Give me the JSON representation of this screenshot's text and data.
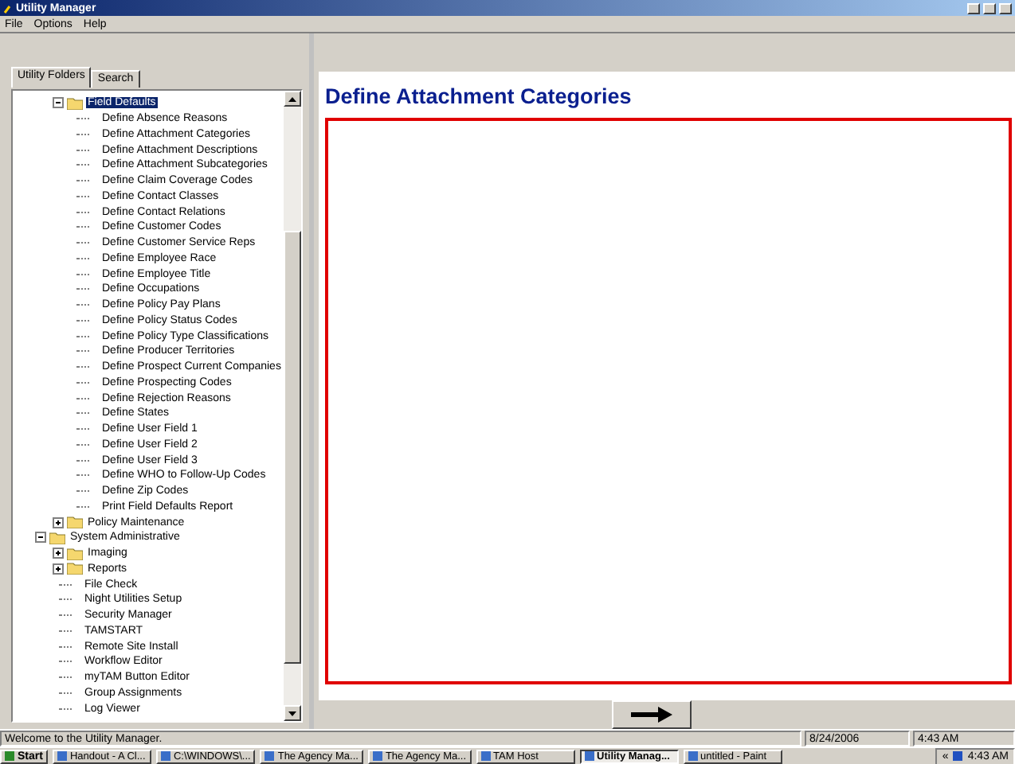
{
  "window": {
    "title": "Utility Manager"
  },
  "menu": [
    "File",
    "Options",
    "Help"
  ],
  "tabs": [
    {
      "label": "Utility Folders",
      "selected": true
    },
    {
      "label": "Search",
      "selected": false
    }
  ],
  "tree": [
    {
      "children": [
        {
          "label": "Field Defaults",
          "kind": "folder",
          "expanded": true,
          "selected": true,
          "children": [
            {
              "label": "Define Absence Reasons",
              "kind": "leaf",
              "selected": false
            },
            {
              "label": "Define Attachment Categories",
              "kind": "leaf",
              "selected": false
            },
            {
              "label": "Define Attachment Descriptions",
              "kind": "leaf",
              "selected": false
            },
            {
              "label": "Define Attachment Subcategories",
              "kind": "leaf",
              "selected": false
            },
            {
              "label": "Define Claim Coverage Codes",
              "kind": "leaf",
              "selected": false
            },
            {
              "label": "Define Contact Classes",
              "kind": "leaf",
              "selected": false
            },
            {
              "label": "Define Contact Relations",
              "kind": "leaf",
              "selected": false
            },
            {
              "label": "Define Customer Codes",
              "kind": "leaf",
              "selected": false
            },
            {
              "label": "Define Customer Service Reps",
              "kind": "leaf",
              "selected": false
            },
            {
              "label": "Define Employee Race",
              "kind": "leaf",
              "selected": false
            },
            {
              "label": "Define Employee Title",
              "kind": "leaf",
              "selected": false
            },
            {
              "label": "Define Occupations",
              "kind": "leaf",
              "selected": false
            },
            {
              "label": "Define Policy Pay Plans",
              "kind": "leaf",
              "selected": false
            },
            {
              "label": "Define Policy Status Codes",
              "kind": "leaf",
              "selected": false
            },
            {
              "label": "Define Policy Type Classifications",
              "kind": "leaf",
              "selected": false
            },
            {
              "label": "Define Producer Territories",
              "kind": "leaf",
              "selected": false
            },
            {
              "label": "Define Prospect Current Companies",
              "kind": "leaf",
              "selected": false
            },
            {
              "label": "Define Prospecting Codes",
              "kind": "leaf",
              "selected": false
            },
            {
              "label": "Define Rejection Reasons",
              "kind": "leaf",
              "selected": false
            },
            {
              "label": "Define States",
              "kind": "leaf",
              "selected": false
            },
            {
              "label": "Define User Field 1",
              "kind": "leaf",
              "selected": false
            },
            {
              "label": "Define User Field 2",
              "kind": "leaf",
              "selected": false
            },
            {
              "label": "Define User Field 3",
              "kind": "leaf",
              "selected": false
            },
            {
              "label": "Define WHO to Follow-Up Codes",
              "kind": "leaf",
              "selected": false
            },
            {
              "label": "Define Zip Codes",
              "kind": "leaf",
              "selected": false
            },
            {
              "label": "Print Field Defaults Report",
              "kind": "leaf",
              "selected": false
            }
          ]
        },
        {
          "label": "Policy Maintenance",
          "kind": "folder",
          "expanded": false,
          "selected": false
        }
      ]
    },
    {
      "label": "System Administrative",
      "kind": "folder",
      "expanded": true,
      "selected": false,
      "children": [
        {
          "label": "Imaging",
          "kind": "folder",
          "expanded": false,
          "selected": false
        },
        {
          "label": "Reports",
          "kind": "folder",
          "expanded": false,
          "selected": false
        },
        {
          "label": "File Check",
          "kind": "leaf",
          "selected": false
        },
        {
          "label": "Night Utilities Setup",
          "kind": "leaf",
          "selected": false
        },
        {
          "label": "Security Manager",
          "kind": "leaf",
          "selected": false
        },
        {
          "label": "TAMSTART",
          "kind": "leaf",
          "selected": false
        },
        {
          "label": "Remote Site Install",
          "kind": "leaf",
          "selected": false
        },
        {
          "label": "Workflow Editor",
          "kind": "leaf",
          "selected": false
        },
        {
          "label": "myTAM Button Editor",
          "kind": "leaf",
          "selected": false
        },
        {
          "label": "Group Assignments",
          "kind": "leaf",
          "selected": false
        },
        {
          "label": "Log Viewer",
          "kind": "leaf",
          "selected": false
        }
      ]
    }
  ],
  "page": {
    "heading": "Define Attachment Categories"
  },
  "status_bar": [
    "Welcome to the Utility Manager.",
    "8/24/2006",
    "4:43 AM"
  ],
  "taskbar": {
    "start": "Start",
    "tasks": [
      {
        "label": "Handout - A Cl...",
        "selected": false
      },
      {
        "label": "C:\\WINDOWS\\...",
        "selected": false
      },
      {
        "label": "The Agency Ma...",
        "selected": false
      },
      {
        "label": "The Agency Ma...",
        "selected": false
      },
      {
        "label": "TAM Host",
        "selected": false
      },
      {
        "label": "Utility Manag...",
        "selected": true
      },
      {
        "label": "untitled - Paint",
        "selected": false
      }
    ],
    "tray_toggle": "«",
    "clock": "4:43 AM"
  }
}
